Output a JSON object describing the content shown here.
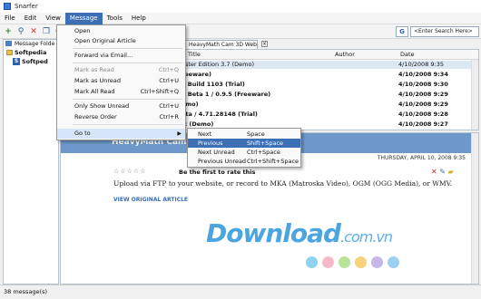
{
  "window": {
    "title": "Snarfer"
  },
  "menubar": [
    "File",
    "Edit",
    "View",
    "Message",
    "Tools",
    "Help"
  ],
  "search": {
    "placeholder": "<Enter Search Here>",
    "engine_icon": "G"
  },
  "left_pane": {
    "header": "Message Folde",
    "tree": [
      "Softpedia",
      "Softped"
    ]
  },
  "tab": {
    "label": "HeavyMath Cam 3D Webm..."
  },
  "list": {
    "columns": [
      "Title",
      "Author",
      "Date"
    ],
    "rows": [
      {
        "title": "aster Edition 3.7 (Demo)",
        "date": "4/10/2008 9:35",
        "bold": false,
        "selected": true
      },
      {
        "title": "reeware)",
        "date": "4/10/2008 9:34",
        "bold": true,
        "selected": false
      },
      {
        "title": "3 Build 1103 (Trial)",
        "date": "4/10/2008 9:30",
        "bold": true,
        "selected": false
      },
      {
        "title": "2 Beta 1 / 0.9.5 (Freeware)",
        "date": "4/10/2008 9:29",
        "bold": true,
        "selected": false
      },
      {
        "title": "emo)",
        "date": "4/10/2008 9:29",
        "bold": true,
        "selected": false
      },
      {
        "title": "eta / 4.71.28148 (Trial)",
        "date": "4/10/2008 9:28",
        "bold": true,
        "selected": false
      },
      {
        "title": "ic (Demo)",
        "date": "4/10/2008 9:27",
        "bold": true,
        "selected": false
      }
    ]
  },
  "reading": {
    "banner_title": "HeavyMath Cam 3D",
    "date": "THURSDAY, APRIL 10, 2008  9:35",
    "stars": "☆☆☆☆☆",
    "rate_text": "Be the first to rate this",
    "body": "Upload via FTP to your website, or record to MKA (Matroska Video), OGM (OGG Media), or WMV.",
    "link": "VIEW ORIGINAL ARTICLE"
  },
  "watermark": {
    "main": "Download",
    "suffix": ".com.vn"
  },
  "dot_colors": [
    "#8fd3f0",
    "#f5b9c9",
    "#b7e39b",
    "#f7d27a",
    "#c7b6e8",
    "#9ad0f2"
  ],
  "status": "38 message(s)",
  "message_menu": [
    {
      "label": "Open",
      "shortcut": "",
      "disabled": false
    },
    {
      "label": "Open Original Article",
      "shortcut": "",
      "disabled": false
    },
    {
      "label": "Forward via Email...",
      "shortcut": "",
      "disabled": false
    },
    {
      "label": "Mark as Read",
      "shortcut": "Ctrl+Q",
      "disabled": true
    },
    {
      "label": "Mark as Unread",
      "shortcut": "Ctrl+U",
      "disabled": false
    },
    {
      "label": "Mark All Read",
      "shortcut": "Ctrl+Shift+Q",
      "disabled": false
    },
    {
      "label": "Only Show Unread",
      "shortcut": "Ctrl+U",
      "disabled": false
    },
    {
      "label": "Reverse Order",
      "shortcut": "Ctrl+R",
      "disabled": false
    },
    {
      "label": "Go to",
      "shortcut": "",
      "disabled": false
    }
  ],
  "goto_submenu": [
    {
      "label": "Next",
      "shortcut": "Space"
    },
    {
      "label": "Previous",
      "shortcut": "Shift+Space"
    },
    {
      "label": "Next Unread",
      "shortcut": "Ctrl+Space"
    },
    {
      "label": "Previous Unread",
      "shortcut": "Ctrl+Shift+Space"
    }
  ]
}
